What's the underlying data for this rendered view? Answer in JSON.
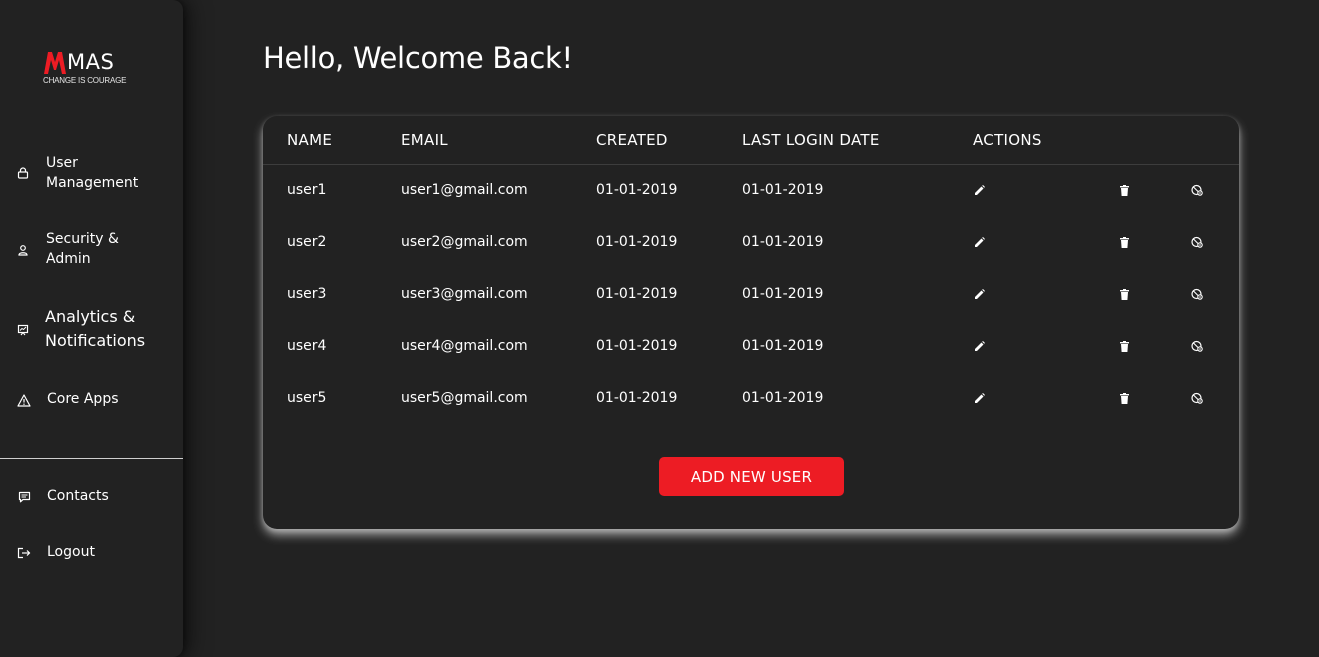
{
  "brand": {
    "name": "MAS",
    "tagline": "CHANGE IS COURAGE",
    "accent": "#ed1c24"
  },
  "sidebar": {
    "items": [
      {
        "label": "User\nManagement",
        "icon": "lock-icon"
      },
      {
        "label": "Security &\nAdmin",
        "icon": "user-icon"
      },
      {
        "label": "Analytics &\nNotifications",
        "icon": "presentation-chart-icon"
      },
      {
        "label": "Core Apps",
        "icon": "warning-triangle-icon"
      }
    ],
    "bottom_items": [
      {
        "label": "Contacts",
        "icon": "message-icon"
      },
      {
        "label": "Logout",
        "icon": "logout-icon"
      }
    ]
  },
  "main": {
    "title": "Hello, Welcome Back!",
    "table": {
      "headers": [
        "NAME",
        "EMAIL",
        "CREATED",
        "LAST LOGIN DATE",
        "ACTIONS"
      ],
      "rows": [
        {
          "name": "user1",
          "email": "user1@gmail.com",
          "created": "01-01-2019",
          "last_login": "01-01-2019"
        },
        {
          "name": "user2",
          "email": "user2@gmail.com",
          "created": "01-01-2019",
          "last_login": "01-01-2019"
        },
        {
          "name": "user3",
          "email": "user3@gmail.com",
          "created": "01-01-2019",
          "last_login": "01-01-2019"
        },
        {
          "name": "user4",
          "email": "user4@gmail.com",
          "created": "01-01-2019",
          "last_login": "01-01-2019"
        },
        {
          "name": "user5",
          "email": "user5@gmail.com",
          "created": "01-01-2019",
          "last_login": "01-01-2019"
        }
      ],
      "action_icons": [
        "edit-icon",
        "delete-icon",
        "reset-password-icon"
      ]
    },
    "add_button_label": "ADD NEW USER"
  }
}
